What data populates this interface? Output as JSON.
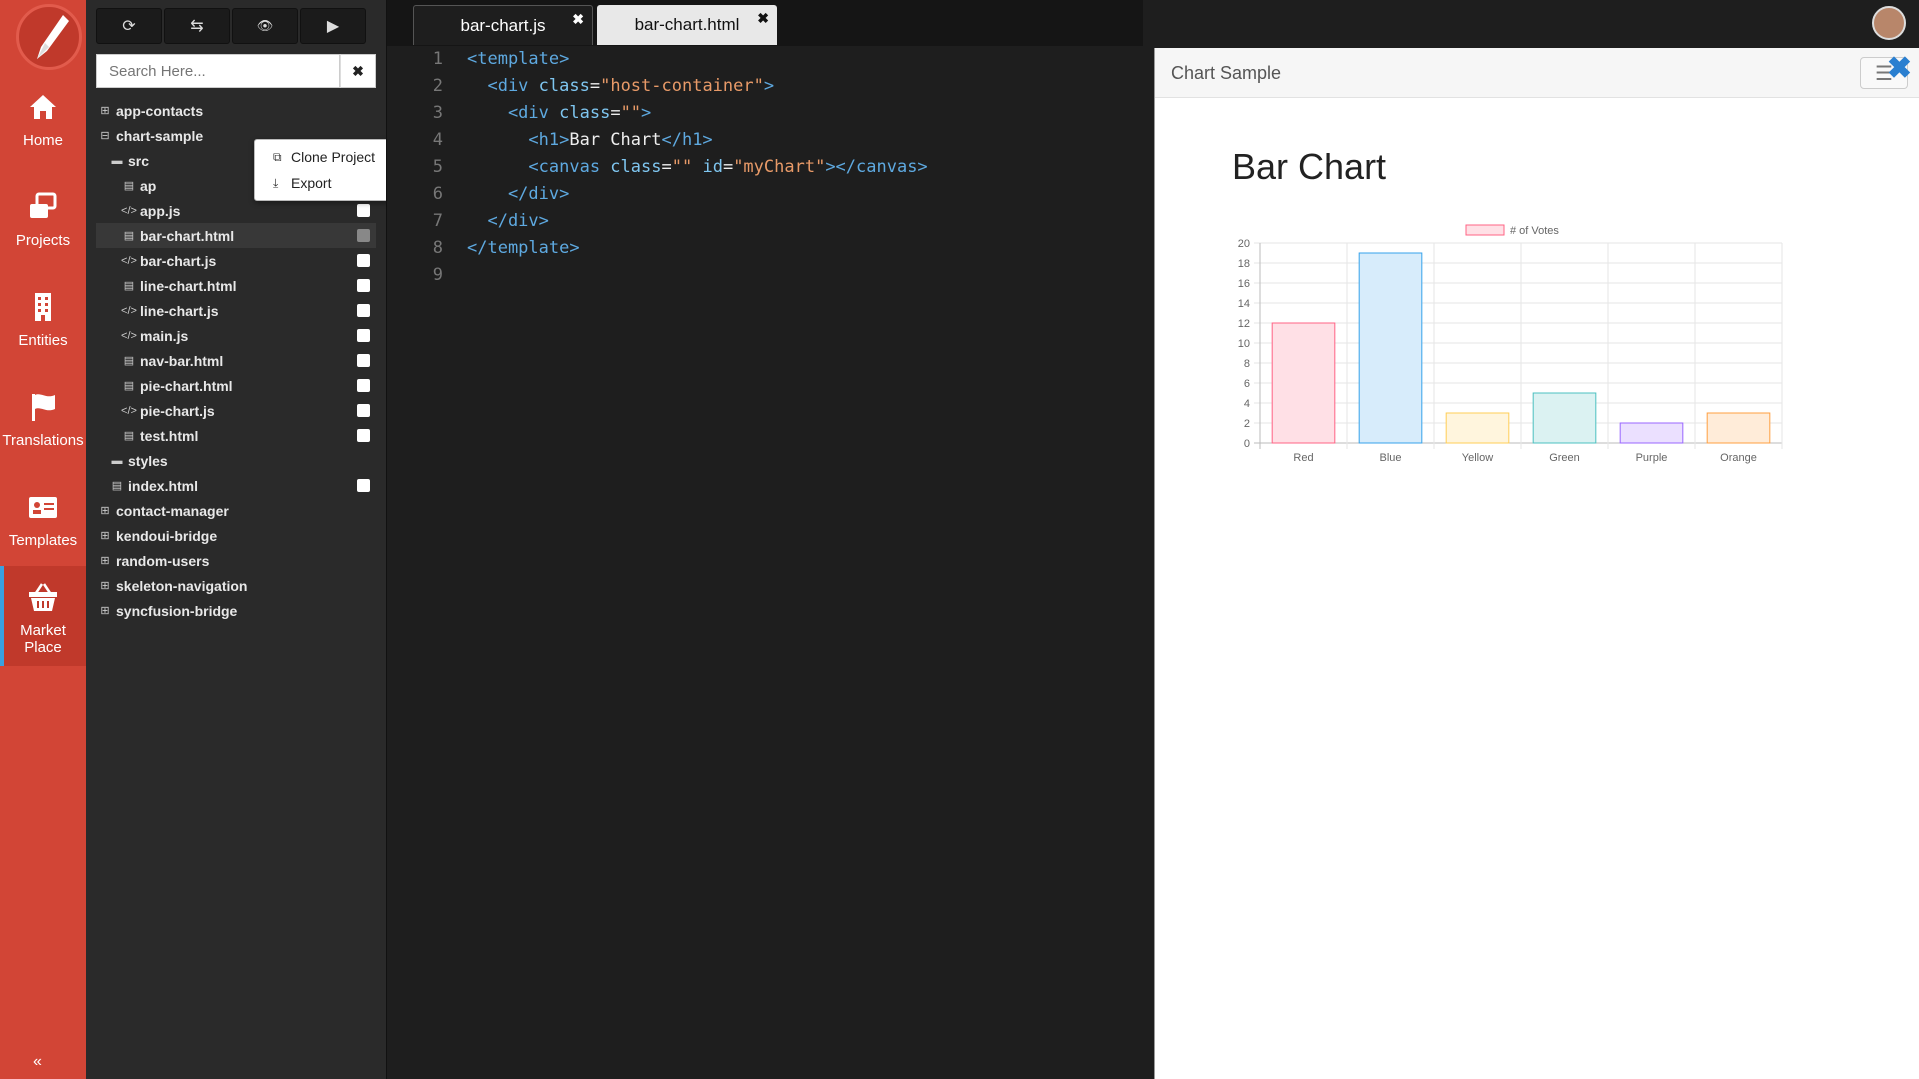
{
  "nav": {
    "items": [
      {
        "label": "Home",
        "icon": "home-icon"
      },
      {
        "label": "Projects",
        "icon": "projects-icon"
      },
      {
        "label": "Entities",
        "icon": "building-icon"
      },
      {
        "label": "Translations",
        "icon": "flag-icon"
      },
      {
        "label": "Templates",
        "icon": "id-card-icon"
      },
      {
        "label": "Market Place",
        "icon": "basket-icon"
      }
    ],
    "collapse_glyph": "«"
  },
  "toolbar": {
    "buttons": [
      {
        "name": "refresh",
        "glyph": "⟳"
      },
      {
        "name": "sync",
        "glyph": "⇆"
      },
      {
        "name": "preview",
        "glyph": "👁"
      },
      {
        "name": "run",
        "glyph": "▶"
      }
    ]
  },
  "search": {
    "placeholder": "Search Here...",
    "clear_glyph": "✖"
  },
  "tree": [
    {
      "label": "app-contacts",
      "type": "project",
      "expanded": false
    },
    {
      "label": "chart-sample",
      "type": "project",
      "expanded": true
    },
    {
      "label": "src",
      "type": "folder-open"
    },
    {
      "label": "ap",
      "type": "html"
    },
    {
      "label": "app.js",
      "type": "js"
    },
    {
      "label": "bar-chart.html",
      "type": "html",
      "selected": true
    },
    {
      "label": "bar-chart.js",
      "type": "js"
    },
    {
      "label": "line-chart.html",
      "type": "html"
    },
    {
      "label": "line-chart.js",
      "type": "js"
    },
    {
      "label": "main.js",
      "type": "js"
    },
    {
      "label": "nav-bar.html",
      "type": "html"
    },
    {
      "label": "pie-chart.html",
      "type": "html"
    },
    {
      "label": "pie-chart.js",
      "type": "js"
    },
    {
      "label": "test.html",
      "type": "html"
    },
    {
      "label": "styles",
      "type": "folder"
    },
    {
      "label": "index.html",
      "type": "html"
    },
    {
      "label": "contact-manager",
      "type": "project",
      "expanded": false
    },
    {
      "label": "kendoui-bridge",
      "type": "project",
      "expanded": false
    },
    {
      "label": "random-users",
      "type": "project",
      "expanded": false
    },
    {
      "label": "skeleton-navigation",
      "type": "project",
      "expanded": false
    },
    {
      "label": "syncfusion-bridge",
      "type": "project",
      "expanded": false
    }
  ],
  "context_menu": {
    "items": [
      {
        "label": "Clone Project",
        "icon": "copy-icon"
      },
      {
        "label": "Export",
        "icon": "download-icon"
      }
    ]
  },
  "editor": {
    "tabs": [
      {
        "label": "bar-chart.js",
        "active": false
      },
      {
        "label": "bar-chart.html",
        "active": true
      }
    ],
    "close_glyph": "✖",
    "lines": [
      {
        "n": "1",
        "tokens": [
          {
            "t": "<template>",
            "c": "tg"
          }
        ]
      },
      {
        "n": "2",
        "tokens": [
          {
            "t": "  <div ",
            "c": "tg"
          },
          {
            "t": "class",
            "c": "at"
          },
          {
            "t": "=",
            "c": "tx"
          },
          {
            "t": "\"host-container\"",
            "c": "sv"
          },
          {
            "t": ">",
            "c": "tg"
          }
        ]
      },
      {
        "n": "3",
        "tokens": [
          {
            "t": "    <div ",
            "c": "tg"
          },
          {
            "t": "class",
            "c": "at"
          },
          {
            "t": "=",
            "c": "tx"
          },
          {
            "t": "\"\"",
            "c": "sv"
          },
          {
            "t": ">",
            "c": "tg"
          }
        ]
      },
      {
        "n": "4",
        "tokens": [
          {
            "t": "      <h1>",
            "c": "tg"
          },
          {
            "t": "Bar Chart",
            "c": "tx"
          },
          {
            "t": "</h1>",
            "c": "tg"
          }
        ]
      },
      {
        "n": "5",
        "tokens": [
          {
            "t": "      <canvas ",
            "c": "tg"
          },
          {
            "t": "class",
            "c": "at"
          },
          {
            "t": "=",
            "c": "tx"
          },
          {
            "t": "\"\" ",
            "c": "sv"
          },
          {
            "t": "id",
            "c": "at"
          },
          {
            "t": "=",
            "c": "tx"
          },
          {
            "t": "\"myChart\"",
            "c": "sv"
          },
          {
            "t": "></canvas>",
            "c": "tg"
          }
        ]
      },
      {
        "n": "6",
        "tokens": [
          {
            "t": "    </div>",
            "c": "tg"
          }
        ]
      },
      {
        "n": "7",
        "tokens": [
          {
            "t": "  </div>",
            "c": "tg"
          }
        ]
      },
      {
        "n": "8",
        "tokens": [
          {
            "t": "</template>",
            "c": "tg"
          }
        ]
      },
      {
        "n": "9",
        "tokens": []
      }
    ]
  },
  "preview": {
    "title": "Chart Sample",
    "menu_glyph": "☰",
    "close_glyph": "✖",
    "heading": "Bar Chart"
  },
  "chart_data": {
    "type": "bar",
    "title": "",
    "xlabel": "",
    "ylabel": "",
    "categories": [
      "Red",
      "Blue",
      "Yellow",
      "Green",
      "Purple",
      "Orange"
    ],
    "series": [
      {
        "name": "# of Votes",
        "values": [
          12,
          19,
          3,
          5,
          2,
          3
        ]
      }
    ],
    "ylim": [
      0,
      20
    ],
    "yticks": [
      "0",
      "2",
      "4",
      "6",
      "8",
      "10",
      "12",
      "14",
      "16",
      "18",
      "20"
    ],
    "grid": true,
    "legend": "top",
    "colors": {
      "fill": [
        "#ffe0e6",
        "#d7ecfb",
        "#fff5dd",
        "#dbf2f2",
        "#ebe0ff",
        "#ffecd9"
      ],
      "stroke": [
        "#ff6384",
        "#36a2eb",
        "#ffce56",
        "#4bc0c0",
        "#9966ff",
        "#ff9f40"
      ]
    }
  },
  "colors": {
    "nav_bg": "#d24536",
    "explorer_bg": "#2a2a2a",
    "editor_bg": "#1e1e1e",
    "accent": "#3aa0e0"
  }
}
